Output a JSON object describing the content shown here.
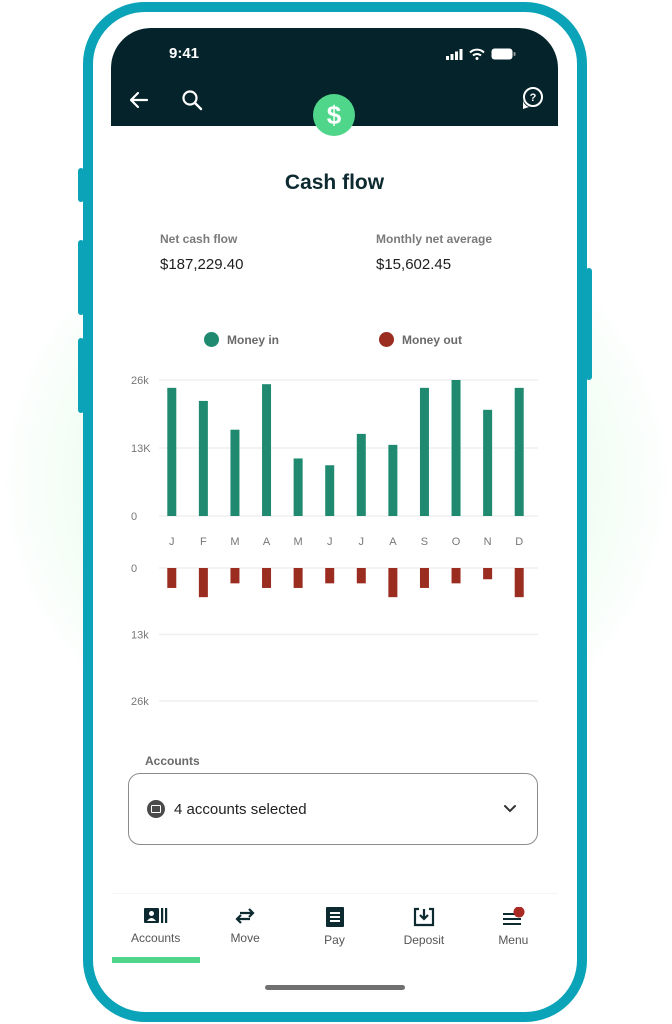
{
  "status_bar": {
    "time": "9:41"
  },
  "header": {
    "back_icon": "arrow-left-icon",
    "search_icon": "search-icon",
    "help_icon": "chat-help-icon",
    "badge_icon": "dollar-icon",
    "badge_symbol": "$"
  },
  "page": {
    "title": "Cash flow",
    "net_cash_flow_label": "Net cash flow",
    "net_cash_flow_value": "$187,229.40",
    "monthly_avg_label": "Monthly net average",
    "monthly_avg_value": "$15,602.45"
  },
  "colors": {
    "money_in": "#1f8a70",
    "money_out": "#9b2c20",
    "accent": "#4fd68a",
    "header_bg": "#04232a",
    "frame": "#0aa3b8"
  },
  "chart_data": {
    "type": "bar",
    "categories": [
      "J",
      "F",
      "M",
      "A",
      "M",
      "J",
      "J",
      "A",
      "S",
      "O",
      "N",
      "D"
    ],
    "series": [
      {
        "name": "Money in",
        "values": [
          24500,
          22000,
          16500,
          25200,
          11000,
          9700,
          15700,
          13600,
          24500,
          26000,
          20300,
          24500
        ]
      },
      {
        "name": "Money out",
        "values": [
          3900,
          5700,
          3000,
          3900,
          3900,
          3000,
          3000,
          5700,
          3900,
          3000,
          2200,
          5700
        ]
      }
    ],
    "legend": [
      "Money in",
      "Money out"
    ],
    "legend_position": "top",
    "upper_axis": {
      "ticks": [
        "0",
        "13K",
        "26k"
      ],
      "ylim": [
        0,
        26000
      ]
    },
    "lower_axis": {
      "ticks": [
        "0",
        "13k",
        "26k"
      ],
      "ylim": [
        0,
        26000
      ]
    },
    "grid": true
  },
  "accounts": {
    "label": "Accounts",
    "selected_text": "4 accounts selected"
  },
  "bottom_nav": {
    "items": [
      {
        "label": "Accounts",
        "icon": "accounts-icon",
        "active": true
      },
      {
        "label": "Move",
        "icon": "transfer-arrows-icon",
        "active": false
      },
      {
        "label": "Pay",
        "icon": "bill-icon",
        "active": false
      },
      {
        "label": "Deposit",
        "icon": "deposit-icon",
        "active": false
      },
      {
        "label": "Menu",
        "icon": "menu-icon",
        "active": false,
        "notification": true
      }
    ]
  }
}
